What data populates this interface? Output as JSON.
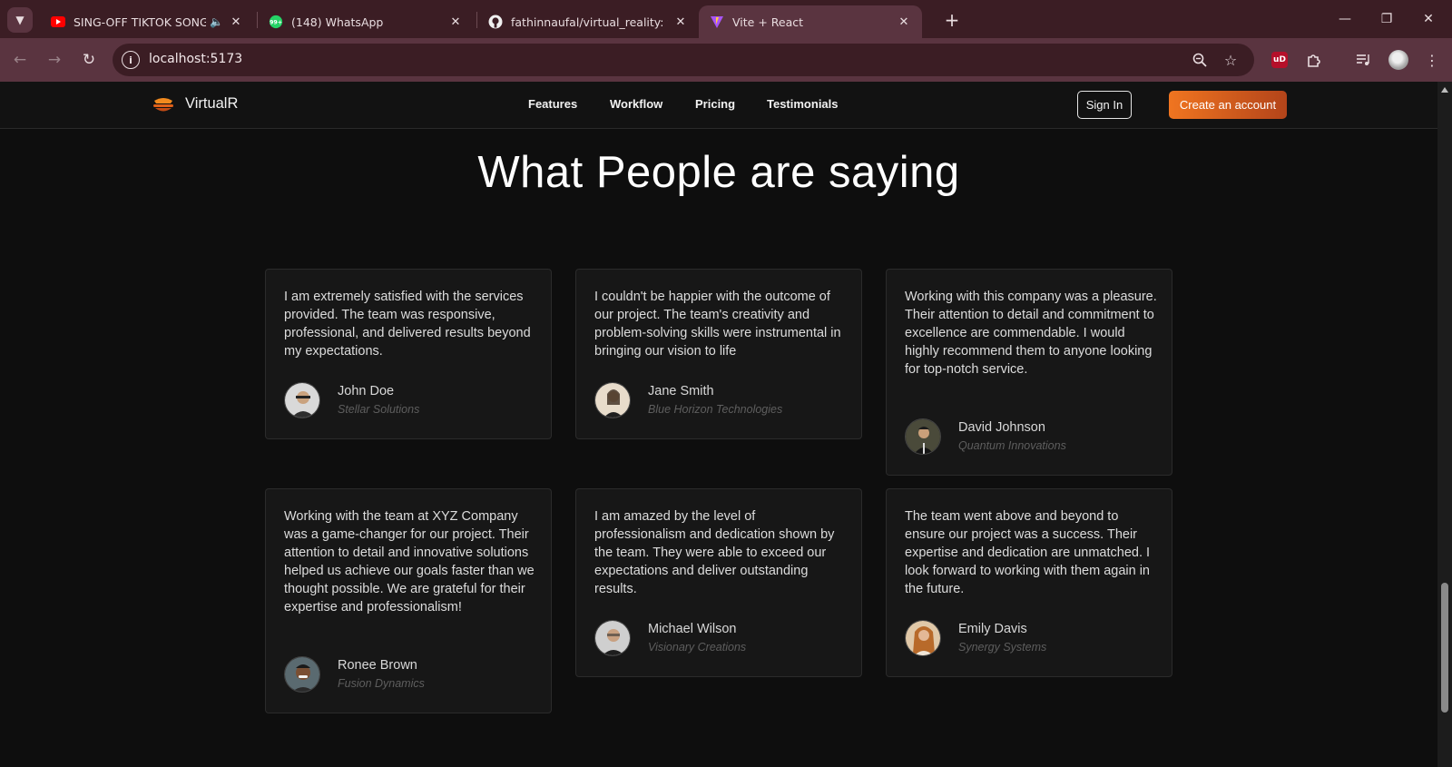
{
  "browser": {
    "tabs": [
      {
        "title": "SING-OFF TIKTOK SONGS P",
        "favicon": "youtube-icon",
        "audio": true,
        "active": false
      },
      {
        "title": "(148) WhatsApp",
        "favicon": "whatsapp-icon",
        "badge": "99+",
        "active": false
      },
      {
        "title": "fathinnaufal/virtual_reality: virtu",
        "favicon": "github-icon",
        "active": false
      },
      {
        "title": "Vite + React",
        "favicon": "vite-icon",
        "active": true
      }
    ],
    "url": "localhost:5173",
    "ublock_label": "uD",
    "colors": {
      "tabbar": "#3b1d24",
      "toolbar": "#5a3440"
    }
  },
  "site": {
    "logo_text": "VirtualR",
    "nav_links": [
      "Features",
      "Workflow",
      "Pricing",
      "Testimonials"
    ],
    "sign_in": "Sign In",
    "create_account": "Create an account",
    "accent": "#f07520"
  },
  "testimonials": {
    "heading": "What People are saying",
    "items": [
      {
        "quote": "I am extremely satisfied with the services provided. The team was responsive, professional, and delivered results beyond my expectations.",
        "name": "John Doe",
        "company": "Stellar Solutions"
      },
      {
        "quote": "I couldn't be happier with the outcome of our project. The team's creativity and problem-solving skills were instrumental in bringing our vision to life",
        "name": "Jane Smith",
        "company": "Blue Horizon Technologies"
      },
      {
        "quote": "Working with this company was a pleasure. Their attention to detail and commitment to excellence are commendable. I would highly recommend them to anyone looking for top-notch service.",
        "name": "David Johnson",
        "company": "Quantum Innovations"
      },
      {
        "quote": "Working with the team at XYZ Company was a game-changer for our project. Their attention to detail and innovative solutions helped us achieve our goals faster than we thought possible. We are grateful for their expertise and professionalism!",
        "name": "Ronee Brown",
        "company": "Fusion Dynamics"
      },
      {
        "quote": "I am amazed by the level of professionalism and dedication shown by the team. They were able to exceed our expectations and deliver outstanding results.",
        "name": "Michael Wilson",
        "company": "Visionary Creations"
      },
      {
        "quote": "The team went above and beyond to ensure our project was a success. Their expertise and dedication are unmatched. I look forward to working with them again in the future.",
        "name": "Emily Davis",
        "company": "Synergy Systems"
      }
    ]
  }
}
